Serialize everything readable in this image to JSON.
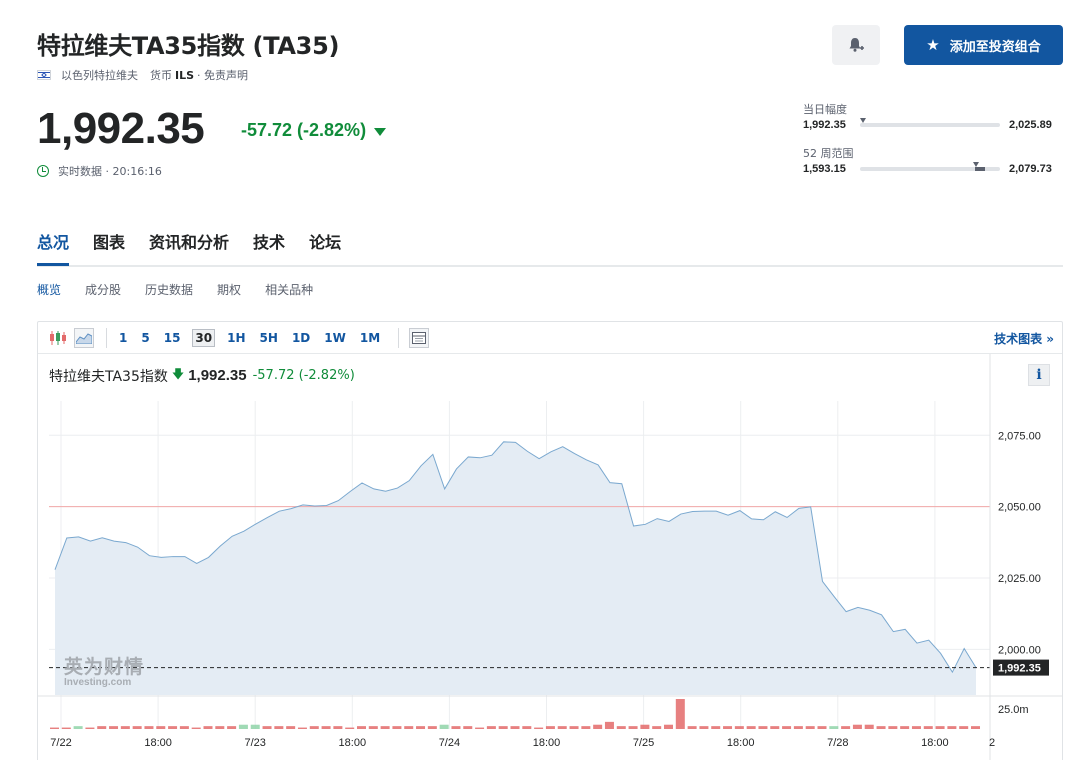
{
  "header": {
    "title": "特拉维夫TA35指数 (TA35)",
    "country": "以色列特拉维夫",
    "currency_label": "货币",
    "currency": "ILS",
    "disclaimer": "· 免责声明",
    "alert_icon": "bell-plus-icon",
    "portfolio_label": "添加至投资组合",
    "accent_color": "#1256a0"
  },
  "quote": {
    "price": "1,992.35",
    "change": "-57.72 (-2.82%)",
    "status": "实时数据 · 20:16:16",
    "change_color": "#108c3a"
  },
  "ranges": {
    "day_label": "当日幅度",
    "day_low": "1,992.35",
    "day_high": "2,025.89",
    "week52_label": "52 周范围",
    "week52_low": "1,593.15",
    "week52_high": "2,079.73"
  },
  "tabs": [
    "总况",
    "图表",
    "资讯和分析",
    "技术",
    "论坛"
  ],
  "subtabs": [
    "概览",
    "成分股",
    "历史数据",
    "期权",
    "相关品种"
  ],
  "chart_toolbar": {
    "periods": [
      "1",
      "5",
      "15",
      "30",
      "1H",
      "5H",
      "1D",
      "1W",
      "1M"
    ],
    "active_period": "30",
    "tech_link": "技术图表 »"
  },
  "legend": {
    "name": "特拉维夫TA35指数",
    "value": "1,992.35",
    "change": "-57.72 (-2.82%)",
    "info": "i"
  },
  "watermark": {
    "cn": "英为财情",
    "en": "Investing.com"
  },
  "chart_data": {
    "type": "area",
    "y_ticks": [
      "2,075.00",
      "2,050.00",
      "2,025.00",
      "2,000.00"
    ],
    "y_tick_values": [
      2075,
      2050,
      2025,
      2000
    ],
    "ylim": [
      1984,
      2087
    ],
    "x_ticks": [
      "7/22",
      "18:00",
      "7/23",
      "18:00",
      "7/24",
      "18:00",
      "7/25",
      "18:00",
      "7/28",
      "18:00",
      "2"
    ],
    "x": [
      0,
      1,
      2,
      3,
      4,
      5,
      6,
      7,
      8,
      9,
      10,
      11,
      12,
      13,
      14,
      15,
      16,
      17,
      18,
      19,
      20,
      21,
      22,
      23,
      24,
      25,
      26,
      27,
      28,
      29,
      30,
      31,
      32,
      33,
      34,
      35,
      36,
      37,
      38,
      39,
      40,
      41,
      42,
      43,
      44,
      45,
      46,
      47,
      48,
      49,
      50,
      51,
      52,
      53,
      54,
      55,
      56,
      57,
      58,
      59,
      60,
      61,
      62,
      63,
      64,
      65,
      66,
      67,
      68,
      69,
      70,
      71,
      72,
      73,
      74,
      75,
      76,
      77,
      78
    ],
    "series": [
      {
        "values": [
          2027.9,
          2039.0,
          2039.4,
          2037.9,
          2039.1,
          2037.9,
          2037.4,
          2035.8,
          2032.8,
          2032.2,
          2032.5,
          2032.5,
          2030.1,
          2032.2,
          2036.2,
          2039.6,
          2041.4,
          2043.9,
          2046.2,
          2048.4,
          2049.3,
          2050.6,
          2050.2,
          2050.4,
          2052.1,
          2055.3,
          2058.3,
          2056.2,
          2055.4,
          2056.5,
          2059.1,
          2064.3,
          2068.3,
          2056.2,
          2063.2,
          2067.4,
          2067.1,
          2068.0,
          2072.7,
          2072.5,
          2069.4,
          2066.8,
          2069.2,
          2071.0,
          2068.6,
          2066.4,
          2064.6,
          2058.4,
          2058.0,
          2043.2,
          2043.8,
          2045.8,
          2044.8,
          2047.4,
          2048.3,
          2048.4,
          2048.4,
          2047.0,
          2048.6,
          2045.7,
          2045.4,
          2048.2,
          2046.2,
          2049.4,
          2049.9,
          2023.8,
          2018.4,
          2013.2,
          2014.7,
          2013.7,
          2012.1,
          2006.2,
          2007.0,
          2002.2,
          2003.2,
          1998.6,
          1992.0,
          2000.3,
          1993.6
        ]
      }
    ],
    "reference_line": 2050,
    "last_value_label": "1,992.35",
    "volume_axis_label": "25.0m",
    "volume": [
      1,
      1,
      2,
      1,
      2,
      2,
      2,
      2,
      2,
      2,
      2,
      2,
      1,
      2,
      2,
      2,
      3,
      3,
      2,
      2,
      2,
      1,
      2,
      2,
      2,
      1,
      2,
      2,
      2,
      2,
      2,
      2,
      2,
      3,
      2,
      2,
      1,
      2,
      2,
      2,
      2,
      1,
      2,
      2,
      2,
      2,
      3,
      5,
      2,
      2,
      3,
      2,
      3,
      21,
      2,
      2,
      2,
      2,
      2,
      2,
      2,
      2,
      2,
      2,
      2,
      2,
      2,
      2,
      3,
      3,
      2,
      2,
      2,
      2,
      2,
      2,
      2,
      2,
      2
    ],
    "volume_up": [
      false,
      false,
      true,
      false,
      false,
      false,
      false,
      false,
      false,
      false,
      false,
      false,
      false,
      false,
      false,
      false,
      true,
      true,
      false,
      false,
      false,
      false,
      false,
      false,
      false,
      false,
      false,
      false,
      false,
      false,
      false,
      false,
      false,
      true,
      false,
      false,
      false,
      false,
      false,
      false,
      false,
      false,
      false,
      false,
      false,
      false,
      false,
      false,
      false,
      false,
      false,
      false,
      false,
      false,
      false,
      false,
      false,
      false,
      false,
      false,
      false,
      false,
      false,
      false,
      false,
      false,
      true,
      false,
      false,
      false,
      false,
      false,
      false,
      false,
      false,
      false,
      false,
      false,
      false
    ],
    "colors": {
      "line": "#7aa8cf",
      "fill": "#e4ecf4",
      "reference": "#f2a8a8",
      "volume_up": "#8fd4a8",
      "volume_down": "#e36a6a"
    }
  }
}
